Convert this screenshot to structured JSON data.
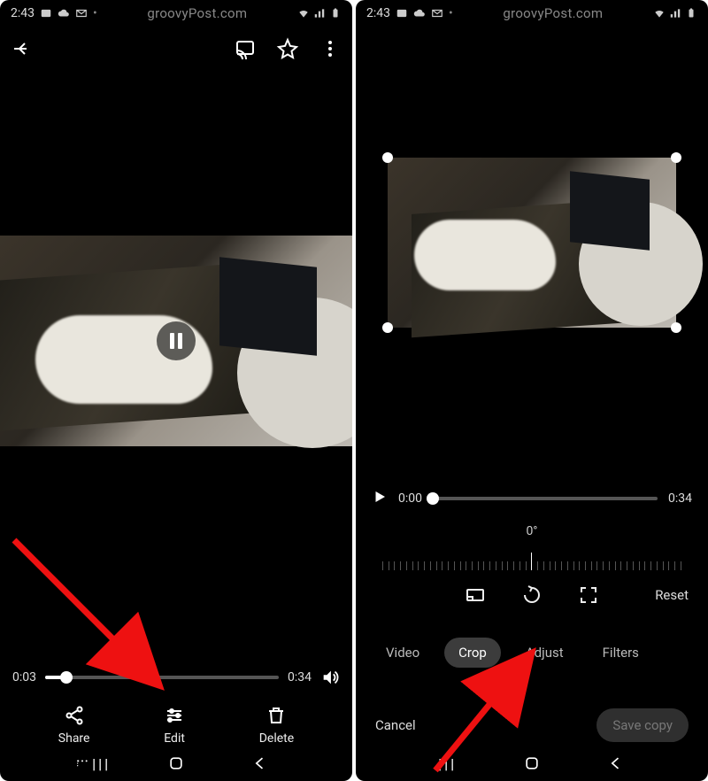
{
  "status": {
    "time": "2:43",
    "site": "groovyPost.com"
  },
  "left": {
    "progress": {
      "current": "0:03",
      "total": "0:34"
    },
    "actions": {
      "share": "Share",
      "edit": "Edit",
      "delete": "Delete"
    }
  },
  "right": {
    "progress": {
      "current": "0:00",
      "total": "0:34"
    },
    "rotation_label": "0°",
    "tools": {
      "reset": "Reset"
    },
    "tabs": {
      "video": "Video",
      "crop": "Crop",
      "adjust": "Adjust",
      "filters": "Filters"
    },
    "cancel": "Cancel",
    "save": "Save copy"
  }
}
